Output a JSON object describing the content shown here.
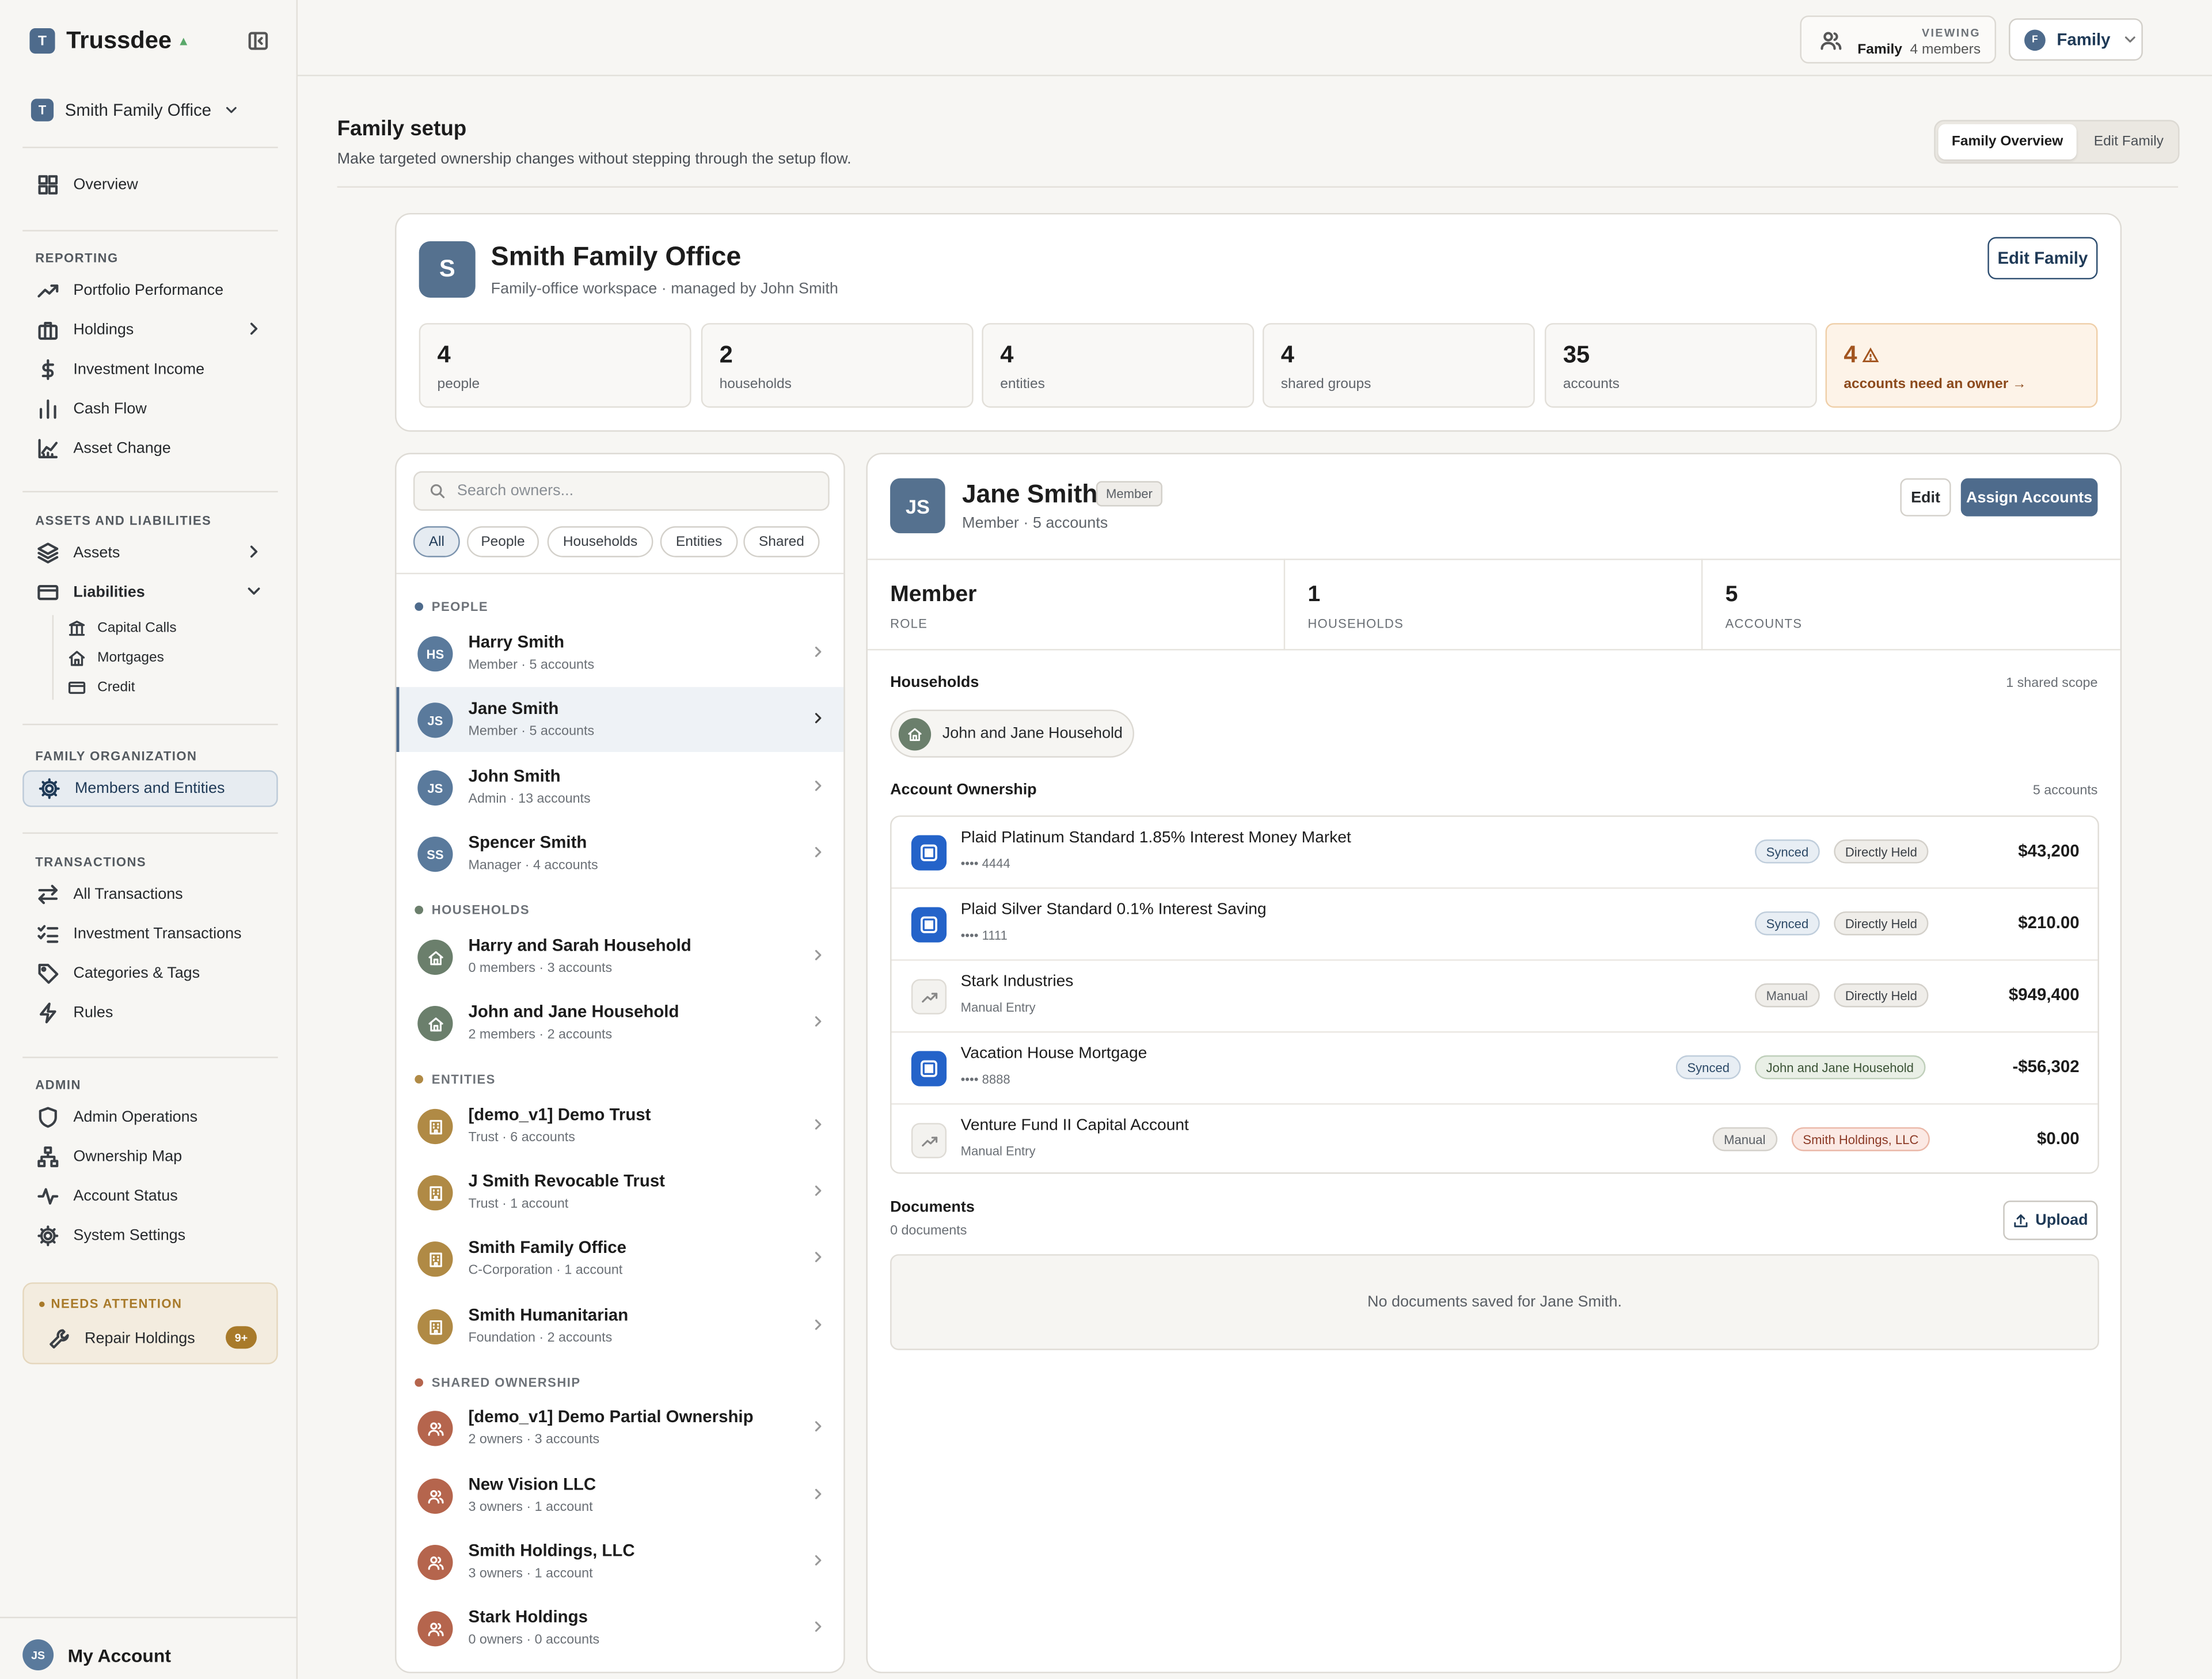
{
  "app": {
    "name": "Trussdee",
    "org_name": "Smith Family Office"
  },
  "sidebar": {
    "overview": "Overview",
    "reporting_title": "REPORTING",
    "reporting": [
      "Portfolio Performance",
      "Holdings",
      "Investment Income",
      "Cash Flow",
      "Asset Change"
    ],
    "assets_title": "ASSETS AND LIABILITIES",
    "assets": "Assets",
    "liabilities": "Liabilities",
    "liability_subs": [
      "Capital Calls",
      "Mortgages",
      "Credit"
    ],
    "family_title": "FAMILY ORGANIZATION",
    "members_entities": "Members and Entities",
    "transactions_title": "TRANSACTIONS",
    "transactions": [
      "All Transactions",
      "Investment Transactions",
      "Categories & Tags",
      "Rules"
    ],
    "admin_title": "ADMIN",
    "admin": [
      "Admin Operations",
      "Ownership Map",
      "Account Status",
      "System Settings"
    ],
    "attention": {
      "title": "NEEDS ATTENTION",
      "item": "Repair Holdings",
      "badge": "9+"
    },
    "account": {
      "initials": "JS",
      "label": "My Account"
    }
  },
  "topbar": {
    "viewing_label": "VIEWING",
    "viewing_scope": "Family",
    "viewing_members": "4 members",
    "family_initial": "F",
    "family_select": "Family"
  },
  "page": {
    "title": "Family setup",
    "subtitle": "Make targeted ownership changes without stepping through the setup flow.",
    "tabs": [
      "Family Overview",
      "Edit Family"
    ]
  },
  "overview": {
    "initial": "S",
    "name": "Smith Family Office",
    "subtitle": "Family-office workspace · managed by John Smith",
    "edit_button": "Edit Family",
    "stats": [
      {
        "value": "4",
        "label": "people"
      },
      {
        "value": "2",
        "label": "households"
      },
      {
        "value": "4",
        "label": "entities"
      },
      {
        "value": "4",
        "label": "shared groups"
      },
      {
        "value": "35",
        "label": "accounts"
      },
      {
        "value": "4",
        "label": "accounts need an owner →"
      }
    ]
  },
  "owners": {
    "search_placeholder": "Search owners...",
    "filters": [
      "All",
      "People",
      "Households",
      "Entities",
      "Shared"
    ],
    "groups": {
      "people": "PEOPLE",
      "households": "HOUSEHOLDS",
      "entities": "ENTITIES",
      "shared": "SHARED OWNERSHIP"
    },
    "people": [
      {
        "initials": "HS",
        "name": "Harry Smith",
        "meta": "Member · 5 accounts"
      },
      {
        "initials": "JS",
        "name": "Jane Smith",
        "meta": "Member · 5 accounts"
      },
      {
        "initials": "JS",
        "name": "John Smith",
        "meta": "Admin · 13 accounts"
      },
      {
        "initials": "SS",
        "name": "Spencer Smith",
        "meta": "Manager · 4 accounts"
      }
    ],
    "households": [
      {
        "name": "Harry and Sarah Household",
        "meta": "0 members · 3 accounts"
      },
      {
        "name": "John and Jane Household",
        "meta": "2 members · 2 accounts"
      }
    ],
    "entities": [
      {
        "name": "[demo_v1] Demo Trust",
        "meta": "Trust · 6 accounts"
      },
      {
        "name": "J Smith Revocable Trust",
        "meta": "Trust · 1 account"
      },
      {
        "name": "Smith Family Office",
        "meta": "C-Corporation · 1 account"
      },
      {
        "name": "Smith Humanitarian",
        "meta": "Foundation · 2 accounts"
      }
    ],
    "shared": [
      {
        "name": "[demo_v1] Demo Partial Ownership",
        "meta": "2 owners · 3 accounts"
      },
      {
        "name": "New Vision LLC",
        "meta": "3 owners · 1 account"
      },
      {
        "name": "Smith Holdings, LLC",
        "meta": "3 owners · 1 account"
      },
      {
        "name": "Stark Holdings",
        "meta": "0 owners · 0 accounts"
      }
    ]
  },
  "detail": {
    "initials": "JS",
    "name": "Jane Smith",
    "tag": "Member",
    "subtitle": "Member · 5 accounts",
    "edit_button": "Edit",
    "assign_button": "Assign Accounts",
    "kpis": [
      {
        "value": "Member",
        "label": "ROLE"
      },
      {
        "value": "1",
        "label": "HOUSEHOLDS"
      },
      {
        "value": "5",
        "label": "ACCOUNTS"
      }
    ],
    "households_title": "Households",
    "households_meta": "1 shared scope",
    "household_pill": "John and Jane Household",
    "ownership_title": "Account Ownership",
    "ownership_meta": "5 accounts",
    "accounts": [
      {
        "name": "Plaid Platinum Standard 1.85% Interest Money Market",
        "sub": "•••• 4444",
        "source": "Synced",
        "holder": "Directly Held",
        "amount": "$43,200",
        "icon": "bank-icon"
      },
      {
        "name": "Plaid Silver Standard 0.1% Interest Saving",
        "sub": "•••• 1111",
        "source": "Synced",
        "holder": "Directly Held",
        "amount": "$210.00",
        "icon": "bank-icon"
      },
      {
        "name": "Stark Industries",
        "sub": "Manual Entry",
        "source": "Manual",
        "holder": "Directly Held",
        "amount": "$949,400",
        "icon": "trend-icon"
      },
      {
        "name": "Vacation House Mortgage",
        "sub": "•••• 8888",
        "source": "Synced",
        "holder": "John and Jane Household",
        "amount": "-$56,302",
        "icon": "bank-icon"
      },
      {
        "name": "Venture Fund II Capital Account",
        "sub": "Manual Entry",
        "source": "Manual",
        "holder": "Smith Holdings, LLC",
        "amount": "$0.00",
        "icon": "trend-icon"
      }
    ],
    "documents_title": "Documents",
    "documents_meta": "0 documents",
    "upload_button": "Upload",
    "documents_empty": "No documents saved for Jane Smith."
  },
  "colors": {
    "accent": "#4e6b8c",
    "household": "#6b7f6c",
    "entity": "#b08a45",
    "shared": "#b5654d",
    "warning": "#a2541f",
    "people_dot": "#4e6b8c"
  }
}
